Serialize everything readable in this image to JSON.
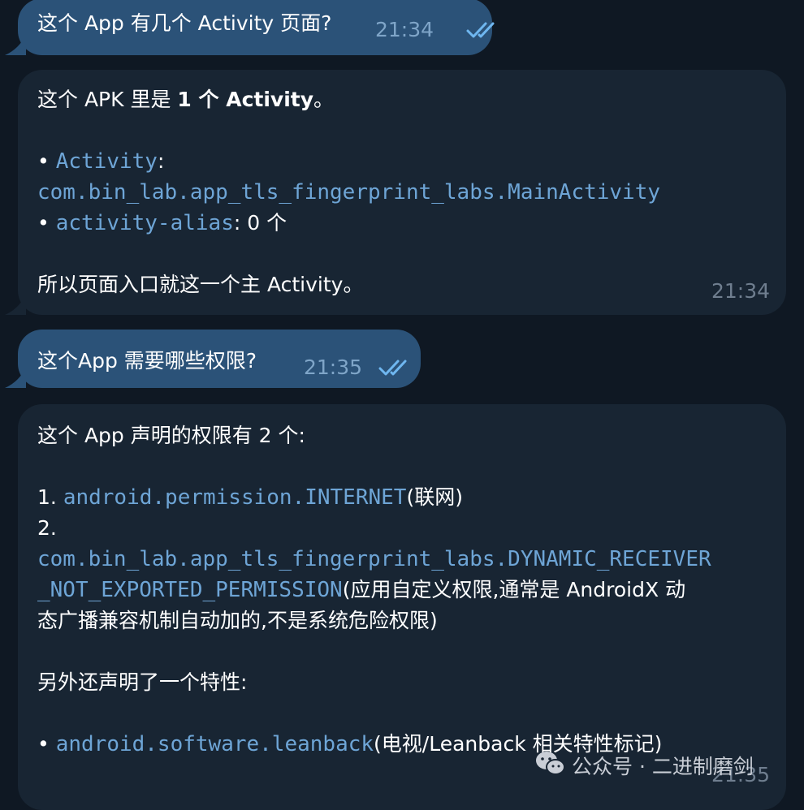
{
  "messages": [
    {
      "text": "这个 App 有几个 Activity 页面?",
      "time": "21:34"
    },
    {
      "intro_a": "这个 APK 里是 ",
      "intro_b": "1 个 Activity",
      "intro_c": "。",
      "b1_bullet": "• ",
      "b1_code": "Activity",
      "b1_colon": ":",
      "b1_value": "com.bin_lab.app_tls_fingerprint_labs.MainActivity",
      "b2_bullet": "• ",
      "b2_code": "activity-alias",
      "b2_rest": ": 0 个",
      "conclusion": "所以页面入口就这一个主 Activity。",
      "time": "21:34"
    },
    {
      "text": "这个App 需要哪些权限?",
      "time": "21:35"
    },
    {
      "intro": "这个 App 声明的权限有 2 个:",
      "p1_num": "1. ",
      "p1_code": "android.permission.INTERNET",
      "p1_note": "(联网)",
      "p2_num": "2.",
      "p2_code_a": "com.bin_lab.app_tls_fingerprint_labs.DYNAMIC_RECEIVER",
      "p2_code_b": "_NOT_EXPORTED_PERMISSION",
      "p2_note_a": "(应用自定义权限,通常是 AndroidX 动",
      "p2_note_b": "态广播兼容机制自动加的,不是系统危险权限)",
      "feature_intro": "另外还声明了一个特性:",
      "f_bullet": "• ",
      "f_code": "android.software.leanback",
      "f_note": "(电视/Leanback 相关特性标记)",
      "time": "21:35"
    }
  ],
  "watermark": "公众号 · 二进制磨剑",
  "colors": {
    "background": "#0f1823",
    "outgoing_bubble": "#2b5278",
    "incoming_bubble": "#182533",
    "code_text": "#6ea5d6",
    "read_check": "#6fb7f0"
  },
  "icons": [
    "double-check-icon",
    "wechat-icon"
  ]
}
